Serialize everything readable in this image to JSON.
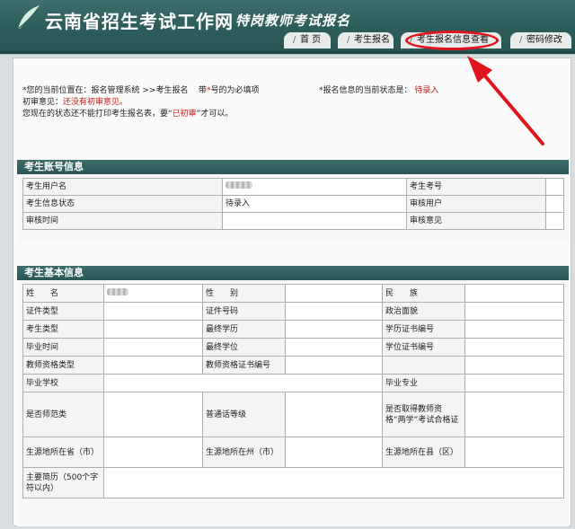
{
  "header": {
    "site_title": "云南省招生考试工作网",
    "sub_title": "特岗教师考试报名",
    "logo_icon": "leaf-logo-icon"
  },
  "nav": {
    "home": "首 页",
    "register": "考生报名",
    "view_info": "考生报名信息查看",
    "change_password": "密码修改"
  },
  "notice": {
    "location_prefix": "*您的当前位置在：报名管理系统 >>考生报名",
    "required_hint_pre": "带",
    "required_star": "*",
    "required_hint_post": "号的为必填项",
    "status_prefix": "*报名信息的当前状态是：",
    "status_value": "待录入",
    "review_label": "初审意见：",
    "review_value": "还没有初审意见。",
    "print_notice_pre": "您现在的状态还不能打印考生报名表，要“",
    "print_notice_highlight": "已初审",
    "print_notice_post": "”才可以。"
  },
  "account_section": {
    "title": "考生账号信息",
    "rows": [
      {
        "label1": "考生用户名",
        "value1": "",
        "label2": "考生考号",
        "value2": ""
      },
      {
        "label1": "考生信息状态",
        "value1": "待录入",
        "label2": "审核用户",
        "value2": ""
      },
      {
        "label1": "审核时间",
        "value1": "",
        "label2": "审核意见",
        "value2": ""
      }
    ]
  },
  "basic_section": {
    "title": "考生基本信息",
    "labels": {
      "name": "姓　　名",
      "gender": "性　　别",
      "ethnicity": "民　　族",
      "id_type": "证件类型",
      "id_number": "证件号码",
      "political": "政治面貌",
      "candidate_type": "考生类型",
      "highest_education": "最终学历",
      "diploma_no": "学历证书编号",
      "graduation_time": "毕业时间",
      "highest_degree": "最终学位",
      "degree_no": "学位证书编号",
      "teacher_cert_type": "教师资格类型",
      "teacher_cert_no": "教师资格证书编号",
      "school": "毕业学校",
      "major": "毕业专业",
      "normal_school": "是否师范类",
      "mandarin_level": "普通话等级",
      "qualification_exam": "是否取得教师资格“两学”考试合格证",
      "source_province": "生源地所在省（市）",
      "source_prefecture": "生源地所在州（市）",
      "source_county": "生源地所在县（区）",
      "resume": "主要简历（500个字符以内）"
    }
  },
  "colors": {
    "header_bg": "#2c5c5a",
    "section_header": "#2f5d5b",
    "alert_red": "#d21a1a",
    "annotation_red": "#e0141c"
  }
}
